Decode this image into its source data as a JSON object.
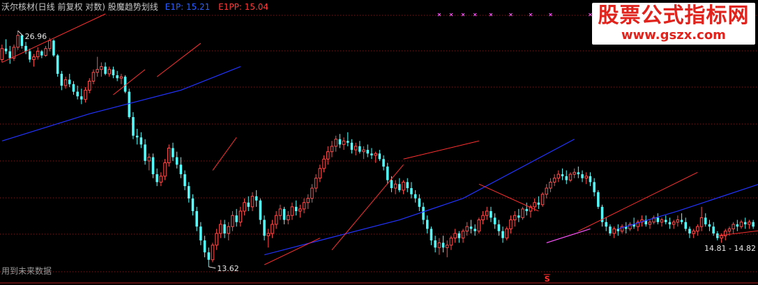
{
  "header": {
    "title": "沃尔核材(日线 前复权 对数) 股魔趋势划线",
    "e1p_label": "E1P",
    "e1p_value": "15.21",
    "e1pp_label": "E1PP",
    "e1pp_value": "15.04"
  },
  "watermark": {
    "name": "股票公式指标网",
    "url": "www.gszx.com"
  },
  "note_text": "用到未来数据",
  "colors": {
    "up": "#ff4d4d",
    "down": "#55ffff",
    "ma_blue": "#2233ff",
    "trend_red": "#ff3030",
    "grid": "#8b1a1a",
    "marker_magenta": "#ff55ff"
  },
  "chart_data": {
    "type": "candlestick",
    "title": "沃尔核材(日线 前复权 对数)",
    "scale": "log",
    "grid": true,
    "ylim": [
      13.0,
      28.3
    ],
    "max_label": "26.96",
    "min_label": "13.62",
    "range_label": "14.81 - 14.82",
    "signal_label": "S",
    "ohlc": [
      [
        24.8,
        25.9,
        24.6,
        25.6
      ],
      [
        25.6,
        26.3,
        25.2,
        25.4
      ],
      [
        25.4,
        25.8,
        24.5,
        24.9
      ],
      [
        24.9,
        25.9,
        24.7,
        25.7
      ],
      [
        25.7,
        26.96,
        25.5,
        26.6
      ],
      [
        26.6,
        26.7,
        25.6,
        25.8
      ],
      [
        25.8,
        26.1,
        25.2,
        25.4
      ],
      [
        25.4,
        25.6,
        24.6,
        24.8
      ],
      [
        24.8,
        25.2,
        24.3,
        25.0
      ],
      [
        25.0,
        25.7,
        24.8,
        25.4
      ],
      [
        25.4,
        25.5,
        24.9,
        25.1
      ],
      [
        25.1,
        25.8,
        25.0,
        25.6
      ],
      [
        25.6,
        26.4,
        25.4,
        26.2
      ],
      [
        26.2,
        26.3,
        25.0,
        25.1
      ],
      [
        25.1,
        25.2,
        23.6,
        23.8
      ],
      [
        23.8,
        24.0,
        22.7,
        23.0
      ],
      [
        23.0,
        23.6,
        22.8,
        23.4
      ],
      [
        23.4,
        23.8,
        22.9,
        23.1
      ],
      [
        23.1,
        23.3,
        22.4,
        22.6
      ],
      [
        22.6,
        23.0,
        22.1,
        22.3
      ],
      [
        22.3,
        22.8,
        21.8,
        22.1
      ],
      [
        22.1,
        22.9,
        21.9,
        22.7
      ],
      [
        22.7,
        23.5,
        22.5,
        23.3
      ],
      [
        23.3,
        24.1,
        23.1,
        23.9
      ],
      [
        23.9,
        25.0,
        23.6,
        24.1
      ],
      [
        24.1,
        24.6,
        23.6,
        24.3
      ],
      [
        24.3,
        24.6,
        23.7,
        23.8
      ],
      [
        23.8,
        24.3,
        23.6,
        24.1
      ],
      [
        24.1,
        24.3,
        23.5,
        23.7
      ],
      [
        23.7,
        24.0,
        23.3,
        23.5
      ],
      [
        23.5,
        23.8,
        23.1,
        23.6
      ],
      [
        23.6,
        23.7,
        22.5,
        22.6
      ],
      [
        22.6,
        22.8,
        20.9,
        21.0
      ],
      [
        21.0,
        21.3,
        19.7,
        19.9
      ],
      [
        19.9,
        20.3,
        19.4,
        19.8
      ],
      [
        19.8,
        20.1,
        19.2,
        19.4
      ],
      [
        19.4,
        19.7,
        18.3,
        18.5
      ],
      [
        18.5,
        18.9,
        18.0,
        18.7
      ],
      [
        18.7,
        18.9,
        17.6,
        17.8
      ],
      [
        17.8,
        18.1,
        17.2,
        17.4
      ],
      [
        17.4,
        17.9,
        17.2,
        17.7
      ],
      [
        17.7,
        18.6,
        17.5,
        18.4
      ],
      [
        18.4,
        19.4,
        18.2,
        19.2
      ],
      [
        19.2,
        19.5,
        18.5,
        18.7
      ],
      [
        18.7,
        19.0,
        18.1,
        18.3
      ],
      [
        18.3,
        18.7,
        17.6,
        17.8
      ],
      [
        17.8,
        18.0,
        17.0,
        17.2
      ],
      [
        17.2,
        17.4,
        16.4,
        16.6
      ],
      [
        16.6,
        16.8,
        15.8,
        16.0
      ],
      [
        16.0,
        16.2,
        15.1,
        15.3
      ],
      [
        15.3,
        15.5,
        14.5,
        14.7
      ],
      [
        14.7,
        14.9,
        14.0,
        14.2
      ],
      [
        14.2,
        14.4,
        13.62,
        13.9
      ],
      [
        13.9,
        14.6,
        13.8,
        14.5
      ],
      [
        14.5,
        15.2,
        14.3,
        15.0
      ],
      [
        15.0,
        15.6,
        14.8,
        15.4
      ],
      [
        15.4,
        15.6,
        14.8,
        15.0
      ],
      [
        15.0,
        15.5,
        14.7,
        15.3
      ],
      [
        15.3,
        16.0,
        15.1,
        15.8
      ],
      [
        15.8,
        16.1,
        15.3,
        15.5
      ],
      [
        15.5,
        16.2,
        15.3,
        16.0
      ],
      [
        16.0,
        16.6,
        15.8,
        16.4
      ],
      [
        16.4,
        16.7,
        16.0,
        16.2
      ],
      [
        16.2,
        16.9,
        16.0,
        16.7
      ],
      [
        16.7,
        17.0,
        16.2,
        16.5
      ],
      [
        16.5,
        16.6,
        15.4,
        15.6
      ],
      [
        15.6,
        15.8,
        14.7,
        14.9
      ],
      [
        14.9,
        15.2,
        14.4,
        15.0
      ],
      [
        15.0,
        15.6,
        14.8,
        15.4
      ],
      [
        15.4,
        16.0,
        15.2,
        15.8
      ],
      [
        15.8,
        16.3,
        15.6,
        16.1
      ],
      [
        16.1,
        16.2,
        15.4,
        15.6
      ],
      [
        15.6,
        16.0,
        15.4,
        15.8
      ],
      [
        15.8,
        16.4,
        15.6,
        16.2
      ],
      [
        16.2,
        16.5,
        15.8,
        16.0
      ],
      [
        16.0,
        16.3,
        15.7,
        16.1
      ],
      [
        16.1,
        16.6,
        15.9,
        16.4
      ],
      [
        16.4,
        16.8,
        16.1,
        16.6
      ],
      [
        16.6,
        17.3,
        16.4,
        17.1
      ],
      [
        17.1,
        17.8,
        16.9,
        17.6
      ],
      [
        17.6,
        18.3,
        17.4,
        18.1
      ],
      [
        18.1,
        18.8,
        17.9,
        18.6
      ],
      [
        18.6,
        19.3,
        18.3,
        19.0
      ],
      [
        19.0,
        19.6,
        18.7,
        19.3
      ],
      [
        19.3,
        19.9,
        19.0,
        19.7
      ],
      [
        19.7,
        20.0,
        19.2,
        19.4
      ],
      [
        19.4,
        19.8,
        19.1,
        19.6
      ],
      [
        19.6,
        20.1,
        19.3,
        19.5
      ],
      [
        19.5,
        19.7,
        18.9,
        19.1
      ],
      [
        19.1,
        19.5,
        18.8,
        19.3
      ],
      [
        19.3,
        19.6,
        18.9,
        19.0
      ],
      [
        19.0,
        19.3,
        18.6,
        19.1
      ],
      [
        19.1,
        19.4,
        18.7,
        18.9
      ],
      [
        18.9,
        19.2,
        18.6,
        18.8
      ],
      [
        18.8,
        19.0,
        18.4,
        18.9
      ],
      [
        18.9,
        19.1,
        18.5,
        18.6
      ],
      [
        18.6,
        18.8,
        18.0,
        18.2
      ],
      [
        18.2,
        18.4,
        17.3,
        17.5
      ],
      [
        17.5,
        17.7,
        16.9,
        17.1
      ],
      [
        17.1,
        17.5,
        16.8,
        17.3
      ],
      [
        17.3,
        17.6,
        16.9,
        17.0
      ],
      [
        17.0,
        17.5,
        16.8,
        17.4
      ],
      [
        17.4,
        17.6,
        16.9,
        17.1
      ],
      [
        17.1,
        17.4,
        16.6,
        16.8
      ],
      [
        16.8,
        17.0,
        16.4,
        16.6
      ],
      [
        16.6,
        16.8,
        16.0,
        16.2
      ],
      [
        16.2,
        16.4,
        15.4,
        15.6
      ],
      [
        15.6,
        15.8,
        15.0,
        15.2
      ],
      [
        15.2,
        15.3,
        14.5,
        14.7
      ],
      [
        14.7,
        14.9,
        14.2,
        14.4
      ],
      [
        14.4,
        14.8,
        14.1,
        14.6
      ],
      [
        14.6,
        14.9,
        14.2,
        14.4
      ],
      [
        14.4,
        14.7,
        14.0,
        14.5
      ],
      [
        14.5,
        14.9,
        14.3,
        14.8
      ],
      [
        14.8,
        15.2,
        14.6,
        15.0
      ],
      [
        15.0,
        15.1,
        14.6,
        14.8
      ],
      [
        14.8,
        15.2,
        14.6,
        15.1
      ],
      [
        15.1,
        15.5,
        14.9,
        15.3
      ],
      [
        15.3,
        15.6,
        15.0,
        15.2
      ],
      [
        15.2,
        15.4,
        14.9,
        15.1
      ],
      [
        15.1,
        15.7,
        15.0,
        15.6
      ],
      [
        15.6,
        16.0,
        15.4,
        15.8
      ],
      [
        15.8,
        16.2,
        15.6,
        16.0
      ],
      [
        16.0,
        16.2,
        15.5,
        15.7
      ],
      [
        15.7,
        15.9,
        15.2,
        15.4
      ],
      [
        15.4,
        15.6,
        14.9,
        15.1
      ],
      [
        15.1,
        15.3,
        14.6,
        14.8
      ],
      [
        14.8,
        15.3,
        14.7,
        15.2
      ],
      [
        15.2,
        15.8,
        15.0,
        15.6
      ],
      [
        15.6,
        16.0,
        15.3,
        15.8
      ],
      [
        15.8,
        16.1,
        15.5,
        15.7
      ],
      [
        15.7,
        16.2,
        15.6,
        16.1
      ],
      [
        16.1,
        16.4,
        15.8,
        16.0
      ],
      [
        16.0,
        16.3,
        15.7,
        16.2
      ],
      [
        16.2,
        16.6,
        16.0,
        16.4
      ],
      [
        16.4,
        16.7,
        16.1,
        16.3
      ],
      [
        16.3,
        16.9,
        16.2,
        16.8
      ],
      [
        16.8,
        17.3,
        16.6,
        17.1
      ],
      [
        17.1,
        17.6,
        16.9,
        17.4
      ],
      [
        17.4,
        17.8,
        17.2,
        17.6
      ],
      [
        17.6,
        18.0,
        17.4,
        17.8
      ],
      [
        17.8,
        18.1,
        17.5,
        17.7
      ],
      [
        17.7,
        18.0,
        17.3,
        17.5
      ],
      [
        17.5,
        17.9,
        17.4,
        17.8
      ],
      [
        17.8,
        18.1,
        17.6,
        17.9
      ],
      [
        17.9,
        18.2,
        17.6,
        17.8
      ],
      [
        17.8,
        18.0,
        17.4,
        17.6
      ],
      [
        17.6,
        17.9,
        17.3,
        17.7
      ],
      [
        17.7,
        17.9,
        17.2,
        17.4
      ],
      [
        17.4,
        17.6,
        16.7,
        16.9
      ],
      [
        16.9,
        17.0,
        16.1,
        16.2
      ],
      [
        16.2,
        16.3,
        15.3,
        15.5
      ],
      [
        15.5,
        15.7,
        15.1,
        15.3
      ],
      [
        15.3,
        15.4,
        14.9,
        15.0
      ],
      [
        15.0,
        15.3,
        14.8,
        15.2
      ],
      [
        15.2,
        15.4,
        14.9,
        15.1
      ],
      [
        15.1,
        15.4,
        15.0,
        15.3
      ],
      [
        15.3,
        15.5,
        15.0,
        15.2
      ],
      [
        15.2,
        15.5,
        15.1,
        15.4
      ],
      [
        15.4,
        15.7,
        15.2,
        15.3
      ],
      [
        15.3,
        15.6,
        15.1,
        15.5
      ],
      [
        15.5,
        15.8,
        15.3,
        15.6
      ],
      [
        15.6,
        15.8,
        15.3,
        15.4
      ],
      [
        15.4,
        15.6,
        15.2,
        15.5
      ],
      [
        15.5,
        15.8,
        15.4,
        15.7
      ],
      [
        15.7,
        15.9,
        15.4,
        15.5
      ],
      [
        15.5,
        15.7,
        15.3,
        15.6
      ],
      [
        15.6,
        15.8,
        15.4,
        15.5
      ],
      [
        15.5,
        15.7,
        15.2,
        15.4
      ],
      [
        15.4,
        15.6,
        15.2,
        15.5
      ],
      [
        15.5,
        15.8,
        15.3,
        15.6
      ],
      [
        15.6,
        15.9,
        15.4,
        15.5
      ],
      [
        15.5,
        15.7,
        15.1,
        15.2
      ],
      [
        15.2,
        15.3,
        14.8,
        15.0
      ],
      [
        15.0,
        15.2,
        14.8,
        15.1
      ],
      [
        15.1,
        15.4,
        14.9,
        15.3
      ],
      [
        15.3,
        16.2,
        15.1,
        15.7
      ],
      [
        15.7,
        15.9,
        15.3,
        15.4
      ],
      [
        15.4,
        15.6,
        15.1,
        15.3
      ],
      [
        15.3,
        15.5,
        14.9,
        15.0
      ],
      [
        15.0,
        15.1,
        14.7,
        14.8
      ],
      [
        14.8,
        15.0,
        14.6,
        14.9
      ],
      [
        14.9,
        15.2,
        14.7,
        15.1
      ],
      [
        15.1,
        15.3,
        14.9,
        15.2
      ],
      [
        15.2,
        15.5,
        15.0,
        15.4
      ],
      [
        15.4,
        15.6,
        15.1,
        15.3
      ],
      [
        15.3,
        15.6,
        15.2,
        15.5
      ],
      [
        15.5,
        15.7,
        15.2,
        15.4
      ],
      [
        15.4,
        15.6,
        15.2,
        15.5
      ],
      [
        15.5,
        15.6,
        15.2,
        15.3
      ]
    ],
    "ma_line": [
      [
        0,
        19.6
      ],
      [
        22,
        21.2
      ],
      [
        45,
        22.7
      ],
      [
        60,
        24.3
      ],
      [
        66,
        14.1
      ],
      [
        80,
        14.7
      ],
      [
        100,
        15.6
      ],
      [
        116,
        16.6
      ],
      [
        144,
        19.7
      ],
      [
        155,
        15.2
      ],
      [
        170,
        16.0
      ],
      [
        195,
        17.6
      ],
      [
        200,
        15.0
      ],
      [
        225,
        15.4
      ],
      [
        238,
        15.6
      ]
    ],
    "trend_lines": [
      [
        [
          0,
          24.6
        ],
        [
          26,
          28.3
        ]
      ],
      [
        [
          28,
          22.4
        ],
        [
          36,
          24.1
        ]
      ],
      [
        [
          39,
          23.6
        ],
        [
          50,
          26.0
        ]
      ],
      [
        [
          53,
          18.0
        ],
        [
          59,
          19.8
        ]
      ],
      [
        [
          66,
          13.7
        ],
        [
          80,
          14.8
        ]
      ],
      [
        [
          83,
          14.3
        ],
        [
          101,
          18.3
        ]
      ],
      [
        [
          101,
          18.6
        ],
        [
          120,
          19.6
        ]
      ],
      [
        [
          120,
          17.3
        ],
        [
          135,
          16.0
        ]
      ],
      [
        [
          145,
          15.1
        ],
        [
          175,
          17.9
        ]
      ],
      [
        [
          180,
          14.9
        ],
        [
          213,
          15.6
        ]
      ],
      [
        [
          213,
          15.2
        ],
        [
          221,
          15.5
        ]
      ],
      [
        [
          223,
          14.9
        ],
        [
          238,
          15.4
        ]
      ]
    ],
    "magenta_curve": [
      [
        137,
        14.6
      ],
      [
        148,
        15.2
      ]
    ],
    "marker_positions": [
      110,
      113,
      116,
      119,
      123,
      128,
      133,
      138,
      148,
      156,
      163,
      173,
      175,
      179,
      185,
      194
    ]
  }
}
